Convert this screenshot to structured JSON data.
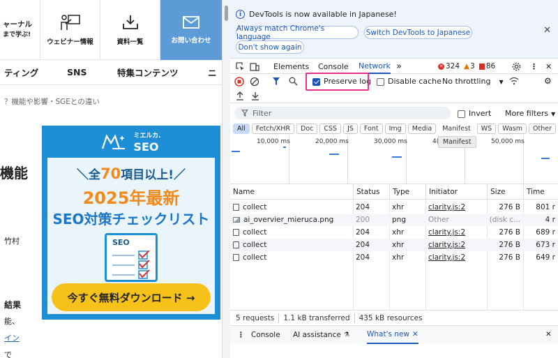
{
  "left_page": {
    "nav": {
      "brand_line1": "ャーナル",
      "brand_line2": "まで学ぶ!",
      "webinar": "ウェビナー情報",
      "docs": "資料一覧",
      "contact": "お問い合わせ"
    },
    "subnav": [
      "ティング",
      "SNS",
      "特集コンテンツ",
      "ニ"
    ],
    "breadcrumb": "？機能や影響・SGEとの違い",
    "side_texts": {
      "heading": "機能",
      "author": "竹村",
      "result": "結果",
      "text_line": "能、",
      "link": "イン",
      "cut": "で"
    },
    "banner": {
      "logo_small": "ミエルカ.",
      "logo": "SEO",
      "line1_prefix": "全",
      "line1_number": "70",
      "line1_suffix": "項目以上!",
      "line2": "2025年最新",
      "line3": "SEO対策チェックリスト",
      "doc_label": "SEO",
      "cta": "今すぐ無料ダウンロード →"
    }
  },
  "devtools": {
    "infobar": {
      "message": "DevTools is now available in Japanese!",
      "btn_match": "Always match Chrome's language",
      "btn_switch": "Switch DevTools to Japanese",
      "btn_dont": "Don't show again"
    },
    "tabs": {
      "elements": "Elements",
      "console": "Console",
      "network": "Network",
      "more": "»",
      "errors": "324",
      "warnings": "3",
      "issues": "86"
    },
    "toolbar": {
      "preserve_log": "Preserve log",
      "disable_cache": "Disable cache",
      "throttling": "No throttling"
    },
    "filter": {
      "placeholder": "Filter",
      "invert": "Invert",
      "more_filters": "More filters"
    },
    "types": [
      "All",
      "Fetch/XHR",
      "Doc",
      "CSS",
      "JS",
      "Font",
      "Img",
      "Media",
      "Manifest",
      "WS",
      "Wasm",
      "Other"
    ],
    "tooltip": "Manifest",
    "overview_labels": [
      "10,000 ms",
      "20,000 ms",
      "30,000 ms",
      "4(",
      "50,000 ms"
    ],
    "columns": {
      "name": "Name",
      "status": "Status",
      "type": "Type",
      "initiator": "Initiator",
      "size": "Size",
      "time": "Time"
    },
    "rows": [
      {
        "name": "collect",
        "status": "204",
        "type": "xhr",
        "initiator": "clarity.js:2",
        "size": "276 B",
        "time": "801 r",
        "icon": "file",
        "muted": false
      },
      {
        "name": "ai_overvier_mieruca.png",
        "status": "200",
        "type": "png",
        "initiator": "Other",
        "size": "(disk c...",
        "time": "4 r",
        "icon": "image",
        "muted": true
      },
      {
        "name": "collect",
        "status": "204",
        "type": "xhr",
        "initiator": "clarity.js:2",
        "size": "276 B",
        "time": "689 r",
        "icon": "file",
        "muted": false
      },
      {
        "name": "collect",
        "status": "204",
        "type": "xhr",
        "initiator": "clarity.js:2",
        "size": "276 B",
        "time": "673 r",
        "icon": "file",
        "muted": false
      },
      {
        "name": "collect",
        "status": "204",
        "type": "xhr",
        "initiator": "clarity.js:2",
        "size": "276 B",
        "time": "649 r",
        "icon": "file",
        "muted": false
      }
    ],
    "status": {
      "requests": "5 requests",
      "transferred": "1.1 kB transferred",
      "resources": "435 kB resources"
    },
    "drawer": {
      "console": "Console",
      "ai": "AI assistance",
      "whats_new": "What's new"
    }
  },
  "colors": {
    "accent": "#1a56b8",
    "highlight": "#e2328a",
    "banner_blue": "#1e8fd6",
    "cta_yellow": "#f6c21a",
    "error_red": "#d93025"
  }
}
